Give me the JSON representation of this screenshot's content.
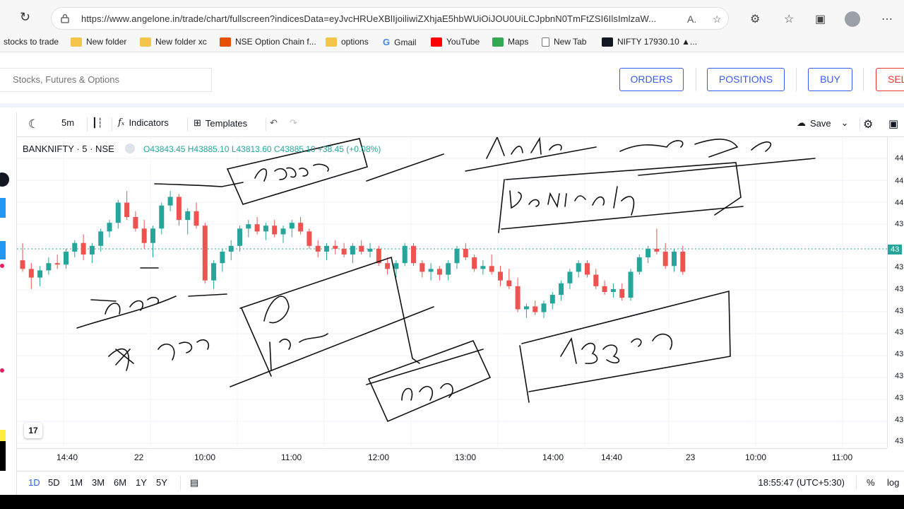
{
  "browser": {
    "url": "https://www.angelone.in/trade/chart/fullscreen?indicesData=eyJvcHRUeXBlIjoiliwiZXhjaE5hbWUiOiJOU0UiLCJpbnN0TmFtZSI6IlsImlzaW..."
  },
  "bookmarks": [
    {
      "label": "stocks to trade",
      "icon": "folder-icon",
      "color": ""
    },
    {
      "label": "New folder",
      "icon": "folder-icon",
      "color": "#f3c54b"
    },
    {
      "label": "New folder xc",
      "icon": "folder-icon",
      "color": "#f3c54b"
    },
    {
      "label": "NSE Option Chain f...",
      "icon": "nse-icon",
      "color": "#e65100"
    },
    {
      "label": "options",
      "icon": "folder-icon",
      "color": "#f3c54b"
    },
    {
      "label": "Gmail",
      "icon": "google-icon",
      "color": "#4285f4"
    },
    {
      "label": "YouTube",
      "icon": "youtube-icon",
      "color": "#ff0000"
    },
    {
      "label": "Maps",
      "icon": "maps-icon",
      "color": "#34a853"
    },
    {
      "label": "New Tab",
      "icon": "page-icon",
      "color": "#777777"
    },
    {
      "label": "NIFTY 17930.10 ▲...",
      "icon": "tradingview-icon",
      "color": "#131722"
    }
  ],
  "header": {
    "search_placeholder": "Stocks, Futures & Options",
    "orders": "ORDERS",
    "positions": "POSITIONS",
    "buy": "BUY",
    "sell": "SEL"
  },
  "toolbar": {
    "interval": "5m",
    "indicators": "Indicators",
    "templates": "Templates",
    "save": "Save"
  },
  "legend": {
    "symbol": "BANKNIFTY · 5 · NSE",
    "ohlc": "O43843.45 H43885.10 L43813.60 C43885.10 +38.45 (+0.08%)"
  },
  "price_labels": [
    "44",
    "44",
    "44",
    "43",
    "43",
    "43",
    "43",
    "43",
    "43",
    "43",
    "43",
    "43",
    "43",
    "43"
  ],
  "current_price_label": "43",
  "time_labels": [
    "14:40",
    "22",
    "10:00",
    "11:00",
    "12:00",
    "13:00",
    "14:00",
    "14:40",
    "23",
    "10:00",
    "11:00"
  ],
  "ranges": [
    "1D",
    "5D",
    "1M",
    "3M",
    "6M",
    "1Y",
    "5Y"
  ],
  "active_range": "1D",
  "clock": "18:55:47 (UTC+5:30)",
  "scale_pct": "%",
  "scale_log": "log",
  "tv_logo": "17",
  "colors": {
    "up": "#26a69a",
    "down": "#ef5350",
    "accent": "#3d5af1"
  },
  "candles": [
    [
      44020,
      44080,
      43980,
      43990
    ],
    [
      43990,
      44010,
      43920,
      43960
    ],
    [
      43960,
      44000,
      43930,
      43985
    ],
    [
      43985,
      44030,
      43970,
      44010
    ],
    [
      44010,
      44040,
      43990,
      44005
    ],
    [
      44005,
      44060,
      43990,
      44050
    ],
    [
      44050,
      44090,
      44030,
      44080
    ],
    [
      44080,
      44110,
      44020,
      44040
    ],
    [
      44040,
      44080,
      44010,
      44070
    ],
    [
      44070,
      44130,
      44050,
      44120
    ],
    [
      44120,
      44160,
      44100,
      44150
    ],
    [
      44150,
      44230,
      44130,
      44220
    ],
    [
      44220,
      44260,
      44160,
      44170
    ],
    [
      44170,
      44190,
      44120,
      44130
    ],
    [
      44130,
      44160,
      44060,
      44080
    ],
    [
      44080,
      44140,
      44030,
      44130
    ],
    [
      44130,
      44220,
      44110,
      44210
    ],
    [
      44210,
      44260,
      44190,
      44240
    ],
    [
      44240,
      44250,
      44140,
      44160
    ],
    [
      44160,
      44200,
      44110,
      44190
    ],
    [
      44190,
      44220,
      44130,
      44140
    ],
    [
      44140,
      44150,
      43940,
      43950
    ],
    [
      43950,
      44020,
      43920,
      44010
    ],
    [
      44010,
      44060,
      43980,
      44050
    ],
    [
      44050,
      44090,
      44020,
      44070
    ],
    [
      44070,
      44140,
      44050,
      44130
    ],
    [
      44130,
      44160,
      44100,
      44145
    ],
    [
      44145,
      44170,
      44110,
      44120
    ],
    [
      44120,
      44150,
      44090,
      44140
    ],
    [
      44140,
      44160,
      44100,
      44110
    ],
    [
      44110,
      44140,
      44080,
      44130
    ],
    [
      44130,
      44160,
      44100,
      44150
    ],
    [
      44150,
      44170,
      44110,
      44120
    ],
    [
      44120,
      44130,
      44060,
      44070
    ],
    [
      44070,
      44090,
      44030,
      44050
    ],
    [
      44050,
      44080,
      44020,
      44070
    ],
    [
      44070,
      44090,
      44040,
      44060
    ],
    [
      44060,
      44080,
      44030,
      44040
    ],
    [
      44040,
      44080,
      44010,
      44070
    ],
    [
      44070,
      44090,
      44040,
      44050
    ],
    [
      44050,
      44080,
      44030,
      44060
    ],
    [
      44060,
      44070,
      44000,
      44010
    ],
    [
      44010,
      44030,
      43970,
      43990
    ],
    [
      43990,
      44020,
      43960,
      44010
    ],
    [
      44010,
      44080,
      44000,
      44070
    ],
    [
      44070,
      44080,
      44000,
      44010
    ],
    [
      44010,
      44020,
      43960,
      43980
    ],
    [
      43980,
      44010,
      43950,
      43990
    ],
    [
      43990,
      44000,
      43950,
      43970
    ],
    [
      43970,
      44020,
      43950,
      44010
    ],
    [
      44010,
      44070,
      43990,
      44060
    ],
    [
      44060,
      44080,
      44020,
      44030
    ],
    [
      44030,
      44040,
      43980,
      43990
    ],
    [
      43990,
      44020,
      43970,
      44000
    ],
    [
      44000,
      44040,
      43970,
      43980
    ],
    [
      43980,
      44000,
      43930,
      43950
    ],
    [
      43950,
      43990,
      43920,
      43930
    ],
    [
      43930,
      43960,
      43840,
      43850
    ],
    [
      43850,
      43870,
      43820,
      43860
    ],
    [
      43860,
      43880,
      43830,
      43840
    ],
    [
      43840,
      43880,
      43820,
      43870
    ],
    [
      43870,
      43910,
      43850,
      43900
    ],
    [
      43900,
      43950,
      43880,
      43940
    ],
    [
      43940,
      43990,
      43920,
      43980
    ],
    [
      43980,
      44020,
      43960,
      44010
    ],
    [
      44010,
      44020,
      43960,
      43970
    ],
    [
      43970,
      43990,
      43920,
      43930
    ],
    [
      43930,
      43950,
      43900,
      43910
    ],
    [
      43910,
      43940,
      43890,
      43920
    ],
    [
      43920,
      43940,
      43880,
      43890
    ],
    [
      43890,
      43990,
      43880,
      43980
    ],
    [
      43980,
      44040,
      43970,
      44030
    ],
    [
      44030,
      44070,
      44010,
      44060
    ],
    [
      44060,
      44130,
      44040,
      44050
    ],
    [
      44050,
      44080,
      43990,
      44000
    ],
    [
      44000,
      44060,
      43980,
      44050
    ],
    [
      44050,
      44070,
      43970,
      43980
    ]
  ]
}
